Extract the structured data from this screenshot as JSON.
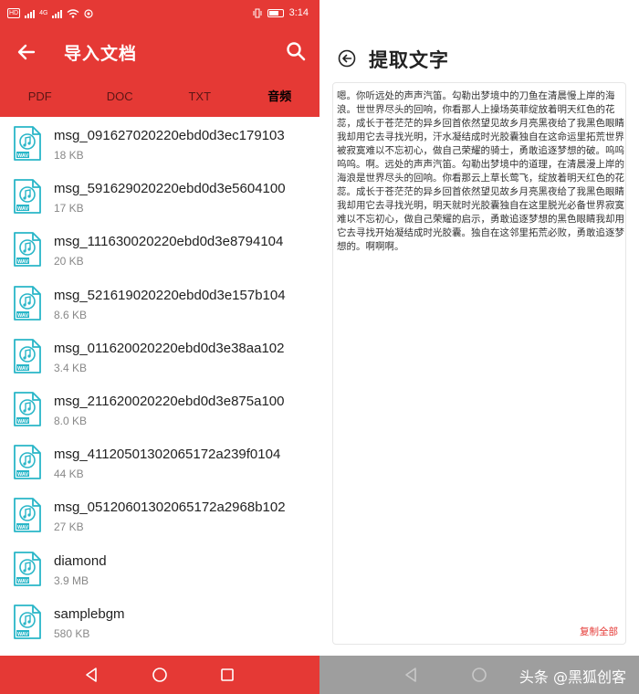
{
  "left_screen": {
    "status_bar": {
      "time": "3:14",
      "hd_label": "HD",
      "net_label": "4G",
      "net_label_2": "4G"
    },
    "toolbar": {
      "title": "导入文档",
      "back_icon": "arrow-left-icon",
      "search_icon": "search-icon"
    },
    "tabs": [
      {
        "label": "PDF"
      },
      {
        "label": "DOC"
      },
      {
        "label": "TXT"
      },
      {
        "label": "音频"
      }
    ],
    "active_tab": "音频",
    "files": [
      {
        "name": "msg_091627020220ebd0d3ec179103",
        "size": "18 KB"
      },
      {
        "name": "msg_591629020220ebd0d3e5604100",
        "size": "17 KB"
      },
      {
        "name": "msg_111630020220ebd0d3e8794104",
        "size": "20 KB"
      },
      {
        "name": "msg_521619020220ebd0d3e157b104",
        "size": "8.6 KB"
      },
      {
        "name": "msg_011620020220ebd0d3e38aa102",
        "size": "3.4 KB"
      },
      {
        "name": "msg_211620020220ebd0d3e875a100",
        "size": "8.0 KB"
      },
      {
        "name": "msg_41120501302065172a239f0104",
        "size": "44 KB"
      },
      {
        "name": "msg_05120601302065172a2968b102",
        "size": "27 KB"
      },
      {
        "name": "diamond",
        "size": "3.9 MB"
      },
      {
        "name": "samplebgm",
        "size": "580 KB"
      }
    ],
    "file_icon_label": "WAV",
    "colors": {
      "accent": "#e53935",
      "file_icon": "#29b6c8"
    }
  },
  "right_screen": {
    "header": {
      "title": "提取文字",
      "back_icon": "circle-arrow-left-icon"
    },
    "ocr_text": "嗯。你听远处的声声汽笛。勾勒出梦境中的刀鱼在清晨慢上岸的海浪。世世界尽头的回响，你看那人上操场英菲绽放着明天红色的花蕊，成长于苍茫茫的异乡回首依然望见故乡月亮黑夜给了我黑色眼睛我却用它去寻找光明，汗水凝结成时光胶囊独自在这命运里拓荒世界被寂寞难以不忘初心，做自己荣耀的骑士，勇敢追逐梦想的破。呜呜呜呜。啊。远处的声声汽笛。勾勒出梦境中的道理，在清晨漫上岸的海浪是世界尽头的回响。你看那云上草长莺飞，绽放着明天红色的花蕊。成长于苍茫茫的异乡回首依然望见故乡月亮黑夜给了我黑色眼睛我却用它去寻找光明，明天就时光胶囊独自在这里脱光必备世界寂寞难以不忘初心，做自己荣耀的启示，勇敢追逐梦想的黑色眼睛我却用它去寻找开始凝结成时光胶囊。独自在这邻里拓荒必败，勇敢追逐梦想的。啊啊啊。",
    "copy_all": "复制全部",
    "watermark": "头条 @黑狐创客"
  }
}
